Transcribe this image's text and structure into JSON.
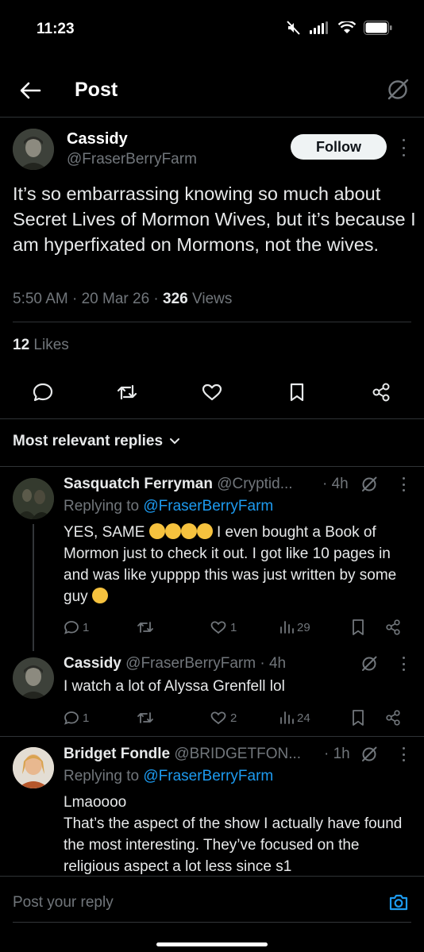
{
  "status_bar": {
    "time": "11:23"
  },
  "header": {
    "title": "Post"
  },
  "post": {
    "author_name": "Cassidy",
    "author_handle": "@FraserBerryFarm",
    "follow_label": "Follow",
    "text": "It’s so embarrassing knowing so much about Secret Lives of Mormon Wives, but it’s because I am hyperfixated on Mormons, not the wives.",
    "time": "5:50 AM · 20 Mar 26 · ",
    "views_count": "326",
    "views_label": " Views",
    "likes_count": "12",
    "likes_label": " Likes"
  },
  "replies_filter": {
    "label": "Most relevant replies"
  },
  "replies": [
    {
      "name": "Sasquatch Ferryman",
      "handle": "@Cryptid...",
      "age": " · 4h",
      "replying_prefix": "Replying to ",
      "replying_to": "@FraserBerryFarm",
      "text_line1": "YES, SAME",
      "text_rest": " I even bought a Book of Mormon just to check it out. I got like 10 pages in and was like yupppp this was just written by some guy",
      "replies_count": "1",
      "reposts_count": "",
      "likes_count": "1",
      "views_count": "29"
    },
    {
      "name": "Cassidy",
      "handle": "@FraserBerryFarm",
      "age": " · 4h",
      "text": "I watch a lot of Alyssa Grenfell lol",
      "replies_count": "1",
      "reposts_count": "",
      "likes_count": "2",
      "views_count": "24"
    },
    {
      "name": "Bridget Fondle",
      "handle": "@BRIDGETFON...",
      "age": " · 1h",
      "replying_prefix": "Replying to ",
      "replying_to": "@FraserBerryFarm",
      "text_line1": "Lmaoooo",
      "text_rest": "That’s the aspect of the show I actually have found the most interesting. They’ve focused on the religious aspect a lot less since s1"
    }
  ],
  "compose": {
    "placeholder": "Post your reply"
  },
  "colors": {
    "accent": "#1d9bf0",
    "muted": "#71767b",
    "text": "#e7e9ea",
    "background": "#000000"
  }
}
